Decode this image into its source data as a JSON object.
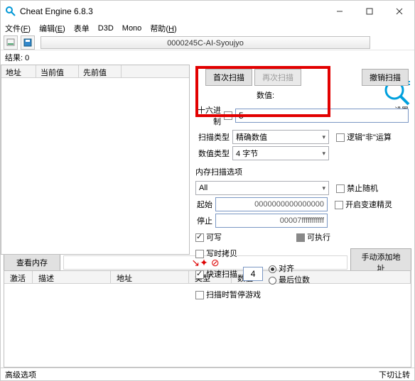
{
  "title": "Cheat Engine 6.8.3",
  "menus": {
    "file": "文件",
    "edit": "编辑",
    "table": "表单",
    "d3d": "D3D",
    "mono": "Mono",
    "help": "帮助"
  },
  "menukeys": {
    "file": "F",
    "edit": "E",
    "help": "H"
  },
  "process": "0000245C-AI-Syoujyo",
  "settings": "设置",
  "results_label": "结果:",
  "results_count": "0",
  "cols": {
    "addr": "地址",
    "cur": "当前值",
    "prev": "先前值"
  },
  "scan": {
    "first": "首次扫描",
    "next": "再次扫描",
    "undo": "撤销扫描"
  },
  "value_label": "数值:",
  "hex_label": "十六进制",
  "value_input": "5",
  "scan_type_label": "扫描类型",
  "scan_type_value": "精确数值",
  "val_type_label": "数值类型",
  "val_type_value": "4 字节",
  "logic_not": "逻辑\"非\"运算",
  "mem_opts": "内存扫描选项",
  "mem_all": "All",
  "start_label": "起始",
  "start_val": "0000000000000000",
  "stop_label": "停止",
  "stop_val": "00007fffffffffff",
  "writable": "可写",
  "executable": "可执行",
  "cow": "写时拷贝",
  "disable_random": "禁止随机",
  "speedhack": "开启变速精灵",
  "fastscan": "快速扫描",
  "fastscan_val": "4",
  "align": "对齐",
  "lastdigits": "最后位数",
  "pause": "扫描时暂停游戏",
  "view_mem": "查看内存",
  "add_manual": "手动添加地址",
  "bottom_cols": {
    "active": "激活",
    "desc": "描述",
    "addr": "地址",
    "type": "类型",
    "value": "数值"
  },
  "adv": "高级选项",
  "tabswitch": "下切让转"
}
